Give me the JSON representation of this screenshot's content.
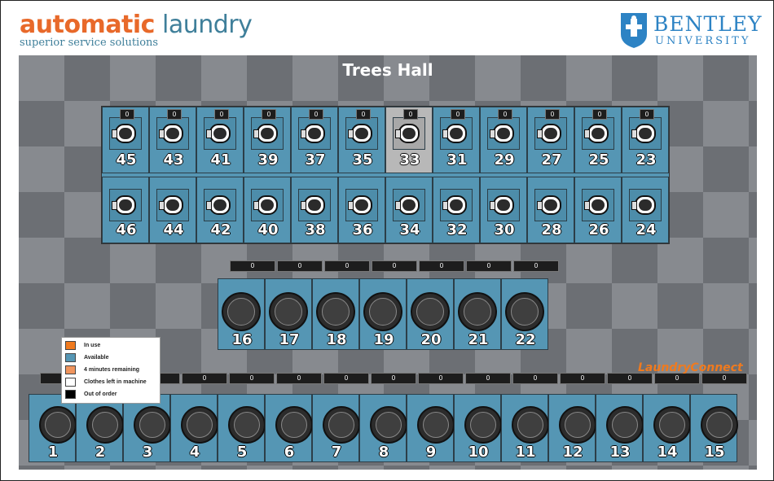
{
  "brand_left": {
    "word1": "automatic",
    "word2": " laundry",
    "tagline": "superior service solutions"
  },
  "brand_right": {
    "name": "BENTLEY",
    "sub": "UNIVERSITY"
  },
  "hall": "Trees Hall",
  "connect": "LaundryConnect",
  "legend": [
    {
      "label": "In use",
      "color": "#f07a1e"
    },
    {
      "label": "Available",
      "color": "#5596b4"
    },
    {
      "label": "4 minutes remaining",
      "color": "#f0955e"
    },
    {
      "label": "Clothes left in machine",
      "color": "#ffffff"
    },
    {
      "label": "Out of order",
      "color": "#000000"
    }
  ],
  "indicator": "0",
  "upper_dryers": [
    "45",
    "43",
    "41",
    "39",
    "37",
    "35",
    "33",
    "31",
    "29",
    "27",
    "25",
    "23"
  ],
  "lower_dryers": [
    "46",
    "44",
    "42",
    "40",
    "38",
    "36",
    "34",
    "32",
    "30",
    "28",
    "26",
    "24"
  ],
  "upper_gray": "33",
  "washers_mid": [
    "16",
    "17",
    "18",
    "19",
    "20",
    "21",
    "22"
  ],
  "washers_bottom": [
    "1",
    "2",
    "3",
    "4",
    "5",
    "6",
    "7",
    "8",
    "9",
    "10",
    "11",
    "12",
    "13",
    "14",
    "15"
  ]
}
